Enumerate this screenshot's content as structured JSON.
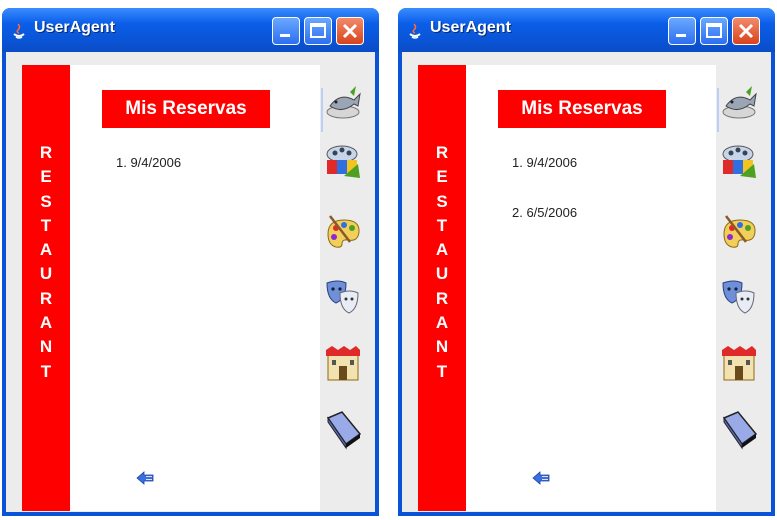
{
  "windows": [
    {
      "title": "UserAgent",
      "vertical_label": [
        "R",
        "E",
        "S",
        "T",
        "A",
        "U",
        "R",
        "A",
        "N",
        "T"
      ],
      "header": "Mis Reservas",
      "reservations": [
        "1. 9/4/2006"
      ],
      "icons": [
        "fish-dish-icon",
        "film-reel-icon",
        "paint-palette-icon",
        "theater-masks-icon",
        "castle-icon",
        "book-icon"
      ],
      "back_icon": "back-arrow-icon"
    },
    {
      "title": "UserAgent",
      "vertical_label": [
        "R",
        "E",
        "S",
        "T",
        "A",
        "U",
        "R",
        "A",
        "N",
        "T"
      ],
      "header": "Mis Reservas",
      "reservations": [
        "1. 9/4/2006",
        "2. 6/5/2006"
      ],
      "icons": [
        "fish-dish-icon",
        "film-reel-icon",
        "paint-palette-icon",
        "theater-masks-icon",
        "castle-icon",
        "book-icon"
      ],
      "back_icon": "back-arrow-icon"
    }
  ],
  "colors": {
    "accent_red": "#ff0000",
    "title_blue": "#0a55d8"
  }
}
